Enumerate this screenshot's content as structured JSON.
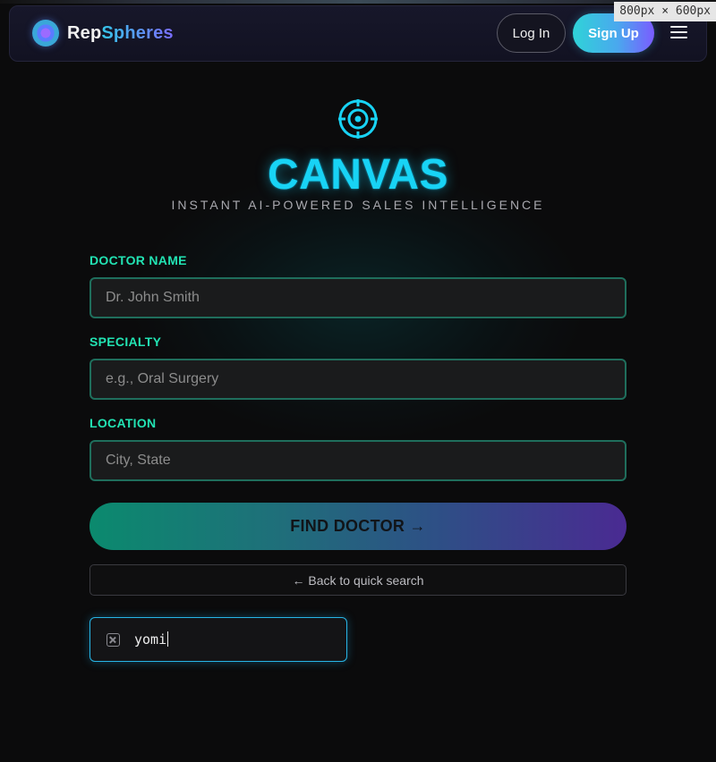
{
  "viewport_badge": "800px × 600px",
  "navbar": {
    "brand_part1": "Rep",
    "brand_part2": "Spheres",
    "login_label": "Log In",
    "signup_label": "Sign Up"
  },
  "hero": {
    "title": "CANVAS",
    "subtitle": "INSTANT AI-POWERED SALES INTELLIGENCE"
  },
  "form": {
    "doctor_name": {
      "label": "DOCTOR NAME",
      "placeholder": "Dr. John Smith",
      "value": ""
    },
    "specialty": {
      "label": "SPECIALTY",
      "placeholder": "e.g., Oral Surgery",
      "value": ""
    },
    "location": {
      "label": "LOCATION",
      "placeholder": "City, State",
      "value": ""
    },
    "find_label": "FIND DOCTOR →",
    "back_label": "← Back to quick search"
  },
  "chip": {
    "text": "yomi"
  },
  "colors": {
    "accent_cyan": "#18d3f5",
    "label_green": "#22e3b3",
    "background": "#0b0b0c"
  }
}
